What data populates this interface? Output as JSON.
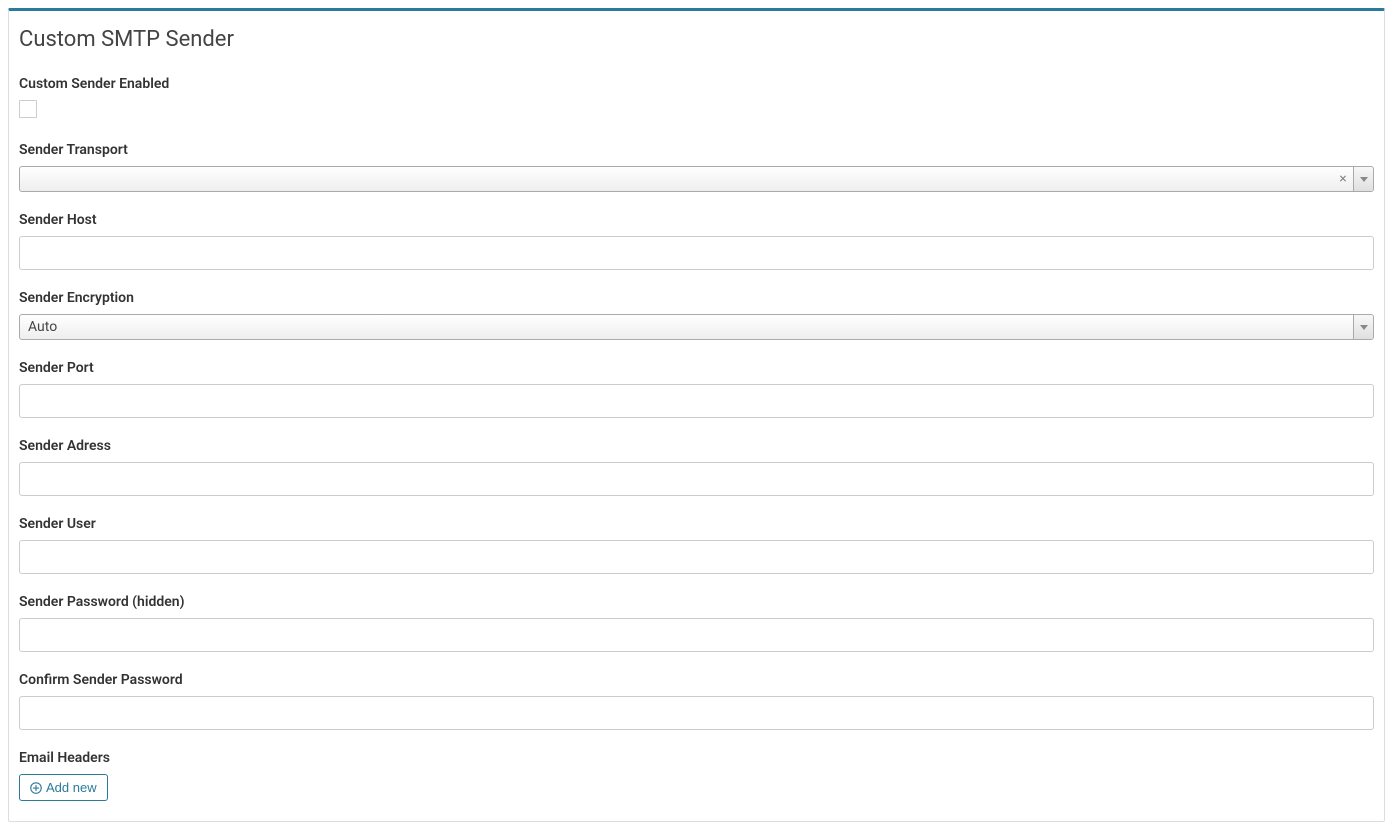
{
  "panel": {
    "title": "Custom SMTP Sender"
  },
  "form": {
    "enabled": {
      "label": "Custom Sender Enabled",
      "checked": false
    },
    "transport": {
      "label": "Sender Transport",
      "value": ""
    },
    "host": {
      "label": "Sender Host",
      "value": ""
    },
    "encryption": {
      "label": "Sender Encryption",
      "value": "Auto"
    },
    "port": {
      "label": "Sender Port",
      "value": ""
    },
    "address": {
      "label": "Sender Adress",
      "value": ""
    },
    "user": {
      "label": "Sender User",
      "value": ""
    },
    "password": {
      "label": "Sender Password (hidden)",
      "value": ""
    },
    "confirm_password": {
      "label": "Confirm Sender Password",
      "value": ""
    },
    "headers": {
      "label": "Email Headers",
      "add_label": "Add new"
    }
  }
}
